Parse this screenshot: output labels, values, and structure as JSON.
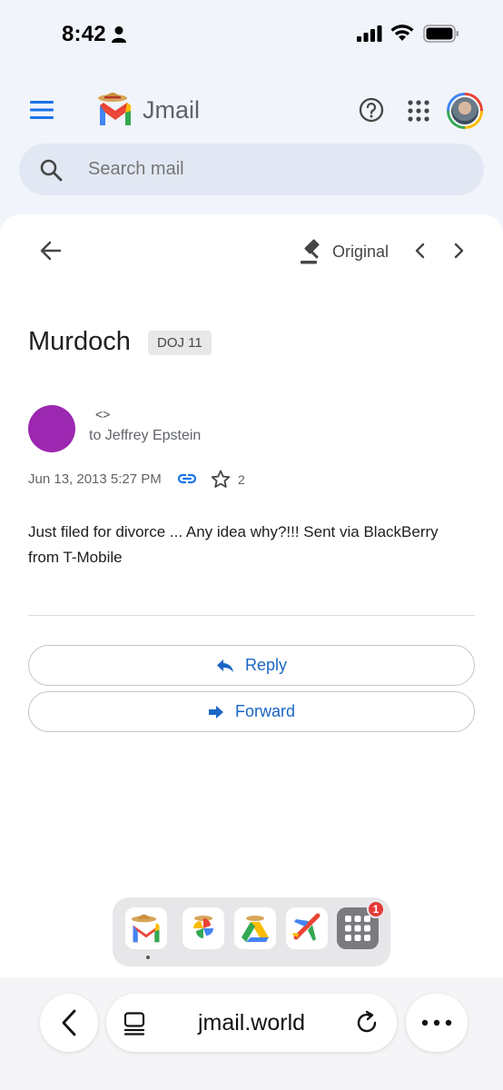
{
  "status_bar": {
    "time": "8:42"
  },
  "app": {
    "brand": "Jmail"
  },
  "search": {
    "placeholder": "Search mail"
  },
  "toolbar": {
    "original_label": "Original"
  },
  "email": {
    "subject": "Murdoch",
    "label": "DOJ 11",
    "sender": "<>",
    "recipient": "to Jeffrey Epstein",
    "date": "Jun 13, 2013 5:27 PM",
    "star_count": "2",
    "body": "Just filed for divorce ... Any idea why?!!! Sent via BlackBerry from T-Mobile"
  },
  "actions": {
    "reply": "Reply",
    "forward": "Forward"
  },
  "dock": {
    "apps_badge": "1"
  },
  "browser": {
    "url": "jmail.world"
  },
  "colors": {
    "accent": "#1a66c5",
    "sender_avatar": "#9c27b0",
    "badge": "#e53935"
  }
}
